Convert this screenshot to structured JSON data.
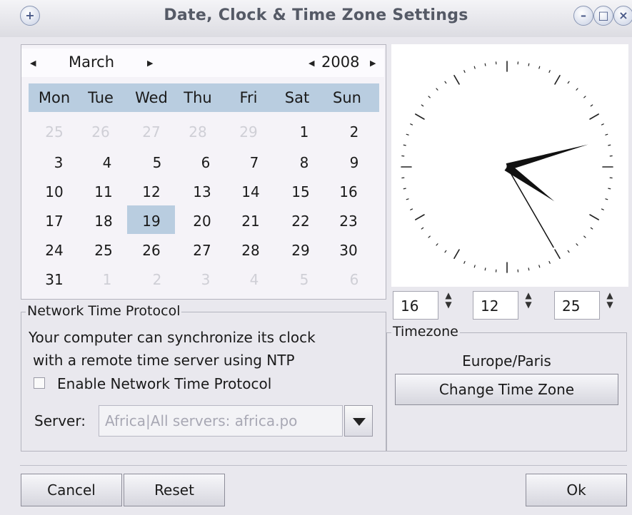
{
  "window": {
    "title": "Date, Clock & Time Zone Settings"
  },
  "calendar": {
    "month": "March",
    "year": "2008",
    "weekdays": [
      "Mon",
      "Tue",
      "Wed",
      "Thu",
      "Fri",
      "Sat",
      "Sun"
    ],
    "rows": [
      [
        "25",
        "26",
        "27",
        "28",
        "29",
        "1",
        "2"
      ],
      [
        "3",
        "4",
        "5",
        "6",
        "7",
        "8",
        "9"
      ],
      [
        "10",
        "11",
        "12",
        "13",
        "14",
        "15",
        "16"
      ],
      [
        "17",
        "18",
        "19",
        "20",
        "21",
        "22",
        "23"
      ],
      [
        "24",
        "25",
        "26",
        "27",
        "28",
        "29",
        "30"
      ],
      [
        "31",
        "1",
        "2",
        "3",
        "4",
        "5",
        "6"
      ]
    ],
    "selected_day": "19"
  },
  "clock": {
    "hours": "16",
    "minutes": "12",
    "seconds": "25"
  },
  "ntp": {
    "legend": "Network Time Protocol",
    "line1": "Your computer can synchronize its clock",
    "line2": "with a remote time server using NTP",
    "enable_label": "Enable Network Time Protocol",
    "enabled": false,
    "server_label": "Server:",
    "server_value": "Africa|All servers: africa.po"
  },
  "timezone": {
    "legend": "Timezone",
    "value": "Europe/Paris",
    "change_button": "Change Time Zone"
  },
  "buttons": {
    "cancel": "Cancel",
    "reset": "Reset",
    "ok": "Ok"
  },
  "icons": {
    "window_menu": "plus-icon",
    "minimize": "minimize-icon",
    "maximize": "maximize-icon",
    "close": "close-icon"
  }
}
